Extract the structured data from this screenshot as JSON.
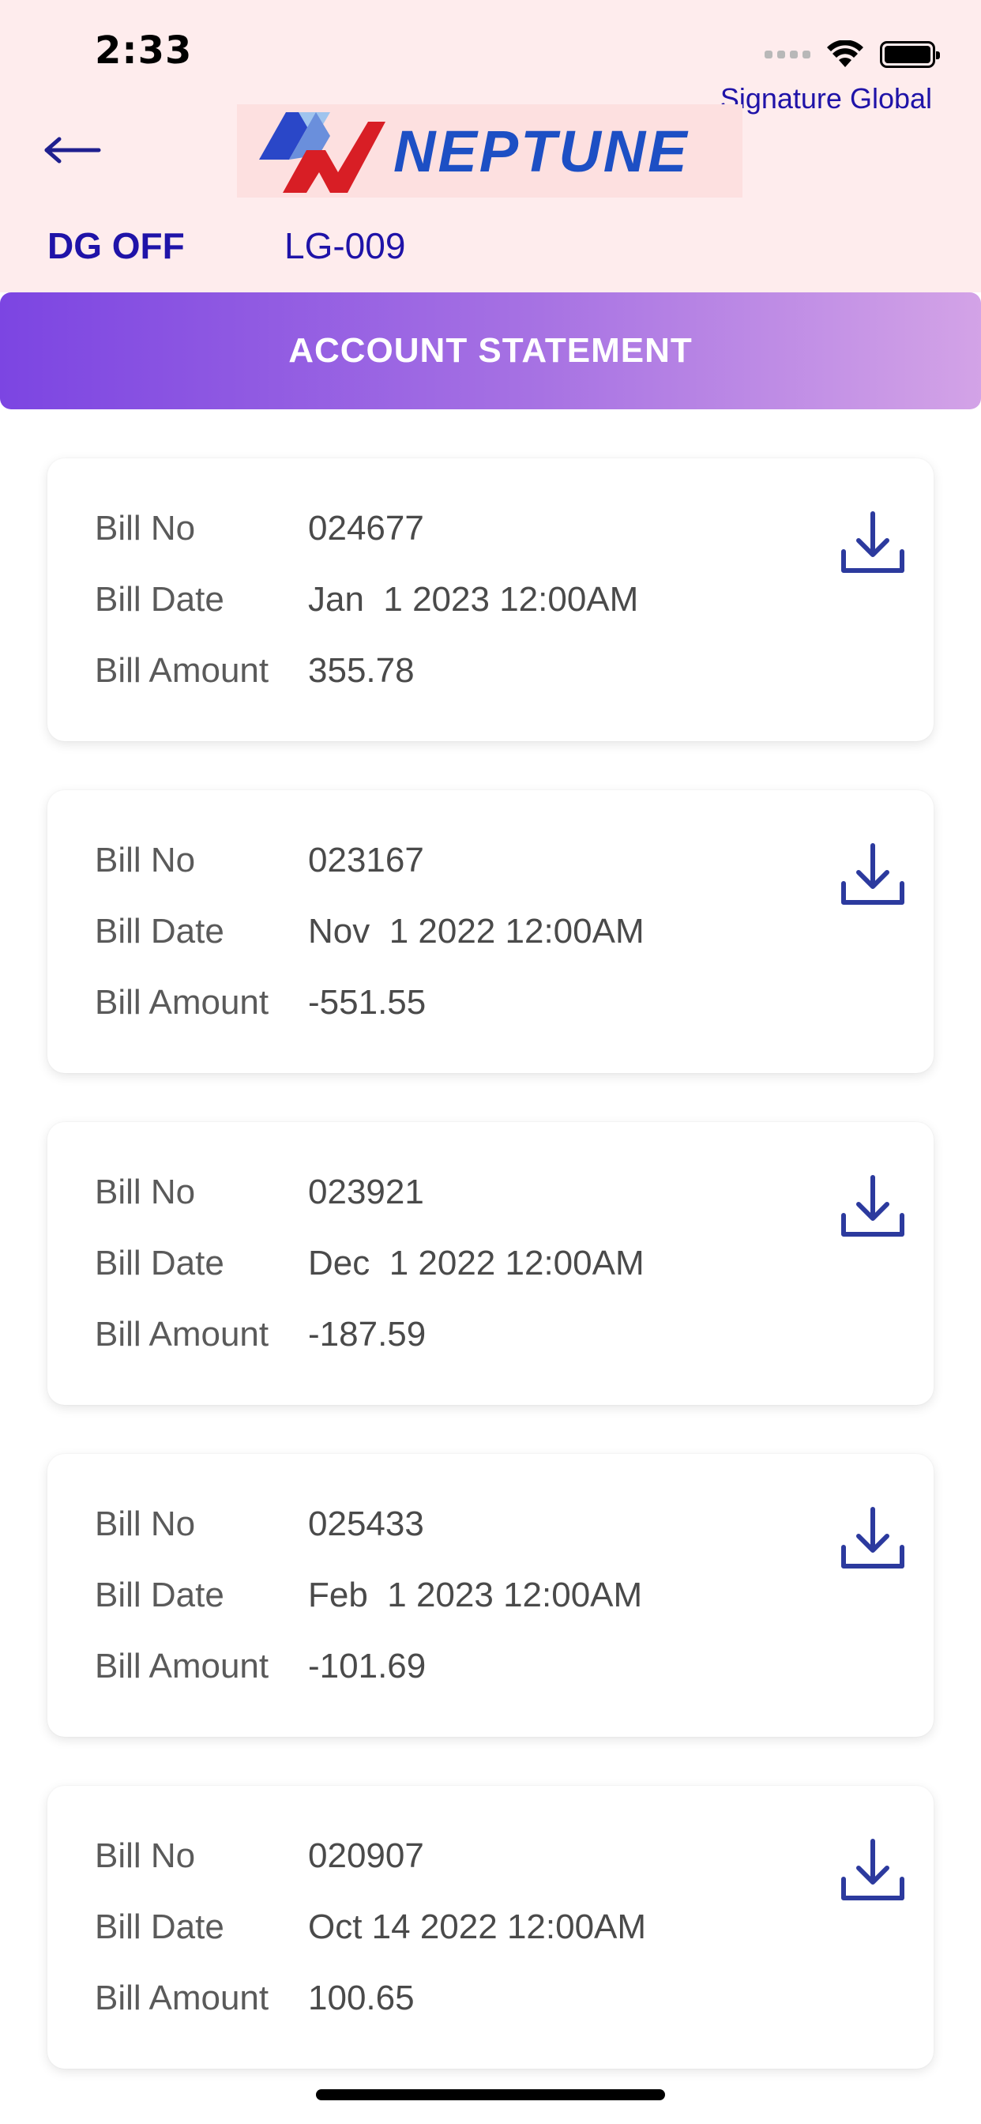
{
  "status_bar": {
    "time": "2:33"
  },
  "header": {
    "org_name": "Signature Global",
    "logo_text": "NEPTUNE",
    "dg_status": "DG OFF",
    "unit_id": "LG-009",
    "back_icon": "arrow-left-icon"
  },
  "banner": {
    "title": "ACCOUNT STATEMENT",
    "colors": [
      "#7c45e2",
      "#d3a3e7"
    ]
  },
  "labels": {
    "bill_no": "Bill No",
    "bill_date": "Bill Date",
    "bill_amount": "Bill Amount"
  },
  "bills": [
    {
      "bill_no": "024677",
      "bill_date": "Jan  1 2023 12:00AM",
      "bill_amount": "355.78"
    },
    {
      "bill_no": "023167",
      "bill_date": "Nov  1 2022 12:00AM",
      "bill_amount": "-551.55"
    },
    {
      "bill_no": "023921",
      "bill_date": "Dec  1 2022 12:00AM",
      "bill_amount": "-187.59"
    },
    {
      "bill_no": "025433",
      "bill_date": "Feb  1 2023 12:00AM",
      "bill_amount": "-101.69"
    },
    {
      "bill_no": "020907",
      "bill_date": "Oct 14 2022 12:00AM",
      "bill_amount": "100.65"
    }
  ],
  "icons": {
    "download": "download-icon",
    "accent": "#2c3a9e"
  }
}
